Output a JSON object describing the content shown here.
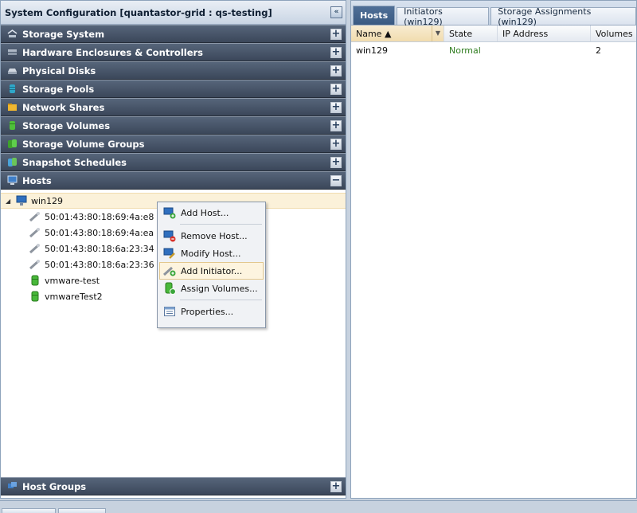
{
  "left_panel": {
    "title": "System Configuration [quantastor-grid : qs-testing]",
    "collapse_glyph": "«",
    "sections": [
      {
        "label": "Storage System",
        "icon": "storage-system-icon",
        "state": "+"
      },
      {
        "label": "Hardware Enclosures & Controllers",
        "icon": "hardware-icon",
        "state": "+"
      },
      {
        "label": "Physical Disks",
        "icon": "disk-icon",
        "state": "+"
      },
      {
        "label": "Storage Pools",
        "icon": "pool-icon",
        "state": "+"
      },
      {
        "label": "Network Shares",
        "icon": "share-icon",
        "state": "+"
      },
      {
        "label": "Storage Volumes",
        "icon": "volume-icon",
        "state": "+"
      },
      {
        "label": "Storage Volume Groups",
        "icon": "volume-group-icon",
        "state": "+"
      },
      {
        "label": "Snapshot Schedules",
        "icon": "schedule-icon",
        "state": "+"
      },
      {
        "label": "Hosts",
        "icon": "host-icon",
        "state": "−"
      }
    ],
    "tree": {
      "host": "win129",
      "expander": "◢",
      "initiators": [
        "50:01:43:80:18:69:4a:e8",
        "50:01:43:80:18:69:4a:ea",
        "50:01:43:80:18:6a:23:34",
        "50:01:43:80:18:6a:23:36"
      ],
      "volumes": [
        "vmware-test",
        "vmwareTest2"
      ]
    },
    "bottom_section": {
      "label": "Host Groups",
      "icon": "host-group-icon",
      "state": "+"
    }
  },
  "right_panel": {
    "tabs": [
      {
        "label": "Hosts",
        "active": true
      },
      {
        "label": "Initiators (win129)",
        "active": false
      },
      {
        "label": "Storage Assignments (win129)",
        "active": false
      }
    ],
    "columns": [
      "Name ▲",
      "State",
      "IP Address",
      "Volumes"
    ],
    "sort_dropdown_glyph": "▼",
    "rows": [
      {
        "name": "win129",
        "state": "Normal",
        "ip": "",
        "volumes": "2"
      }
    ],
    "state_color": "#2f7d1f"
  },
  "context_menu": {
    "items": [
      {
        "label": "Add Host...",
        "icon": "add-host-icon"
      },
      {
        "label": "Remove Host...",
        "icon": "remove-host-icon"
      },
      {
        "label": "Modify Host...",
        "icon": "modify-host-icon"
      },
      {
        "label": "Add Initiator...",
        "icon": "add-initiator-icon",
        "hover": true
      },
      {
        "label": "Assign Volumes...",
        "icon": "assign-volumes-icon"
      },
      {
        "label": "Properties...",
        "icon": "properties-icon"
      }
    ]
  }
}
